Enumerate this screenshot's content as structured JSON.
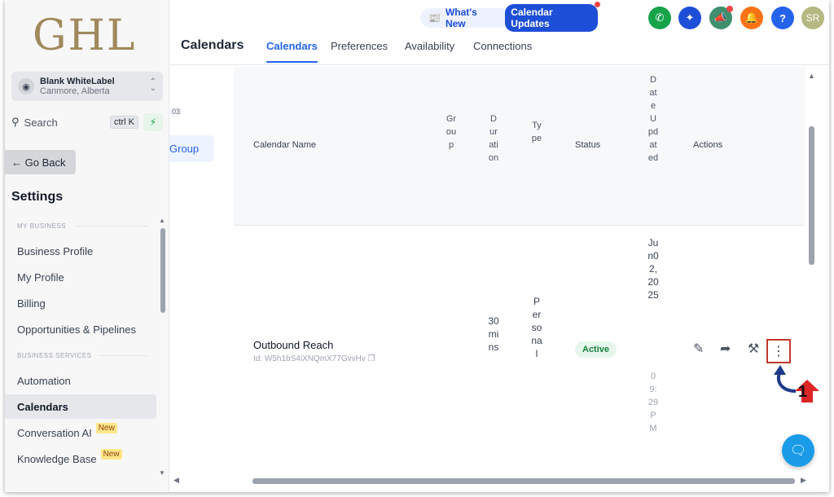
{
  "sidebar": {
    "logo": "GHL",
    "account": {
      "name": "Blank WhiteLabel",
      "location": "Canmore, Alberta"
    },
    "search": {
      "label": "Search",
      "shortcut": "ctrl K"
    },
    "go_back": "Go Back",
    "settings_title": "Settings",
    "sections": [
      {
        "label": "MY BUSINESS"
      },
      {
        "label": "BUSINESS SERVICES"
      }
    ],
    "items": [
      {
        "label": "Business Profile"
      },
      {
        "label": "My Profile"
      },
      {
        "label": "Billing"
      },
      {
        "label": "Opportunities & Pipelines"
      },
      {
        "label": "Automation"
      },
      {
        "label": "Calendars"
      },
      {
        "label": "Conversation AI",
        "badge": "New"
      },
      {
        "label": "Knowledge Base",
        "badge": "New"
      }
    ],
    "active_item": "Calendars"
  },
  "header": {
    "whats_new": "What's New",
    "updates_pill": "Calendar Updates",
    "avatar": "SR",
    "page_title": "Calendars",
    "tabs": [
      {
        "label": "Calendars",
        "active": true
      },
      {
        "label": "Preferences"
      },
      {
        "label": "Availability"
      },
      {
        "label": "Connections"
      }
    ],
    "colors": {
      "phone": "#16a34a",
      "sparkle": "#1d4ed8",
      "megaphone": "#3f8f6e",
      "bell": "#f97316",
      "help": "#2563eb",
      "avatar": "#b5b880"
    }
  },
  "groups": {
    "count": "03",
    "label": "Group"
  },
  "table": {
    "headers": {
      "calendar_name": "Calendar Name",
      "group": "Group",
      "duration": "Duration",
      "type": "Type",
      "status": "Status",
      "date_updated": "DateUpdated",
      "actions": "Actions"
    },
    "rows": [
      {
        "name": "Outbound Reach",
        "id": "Id: W5h1bS4iXNQmX77GvvHv",
        "duration": "30mins",
        "type": "Personal",
        "status": "Active",
        "date": "Jun02,2025",
        "time": "09:29PM"
      }
    ]
  },
  "annotation": {
    "step": "1"
  }
}
